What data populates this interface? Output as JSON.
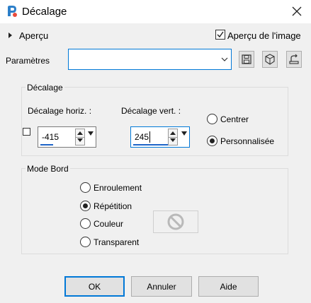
{
  "window": {
    "title": "Décalage",
    "accent": "#0078d7"
  },
  "top": {
    "apercu_label": "Aperçu",
    "apercu_image_label": "Aperçu de l'image",
    "apercu_image_checked": true,
    "parametres_label": "Paramètres",
    "parametres_value": ""
  },
  "decalage": {
    "group_label": "Décalage",
    "horiz_label": "Décalage horiz. :",
    "horiz_value": "-415",
    "vert_label": "Décalage vert. :",
    "vert_value": "245",
    "centrer_label": "Centrer",
    "personnalisee_label": "Personnalisée",
    "selected": "personnalisee"
  },
  "mode_bord": {
    "group_label": "Mode Bord",
    "options": [
      "Enroulement",
      "Répétition",
      "Couleur",
      "Transparent"
    ],
    "selected": "Répétition"
  },
  "buttons": {
    "ok": "OK",
    "cancel": "Annuler",
    "help": "Aide"
  },
  "icons": {
    "app": "paint-shop-pro-icon",
    "close": "close-icon",
    "save": "save-preset-icon",
    "reset": "reset-preset-icon",
    "manage": "manage-presets-icon",
    "no_color": "no-color-icon"
  }
}
